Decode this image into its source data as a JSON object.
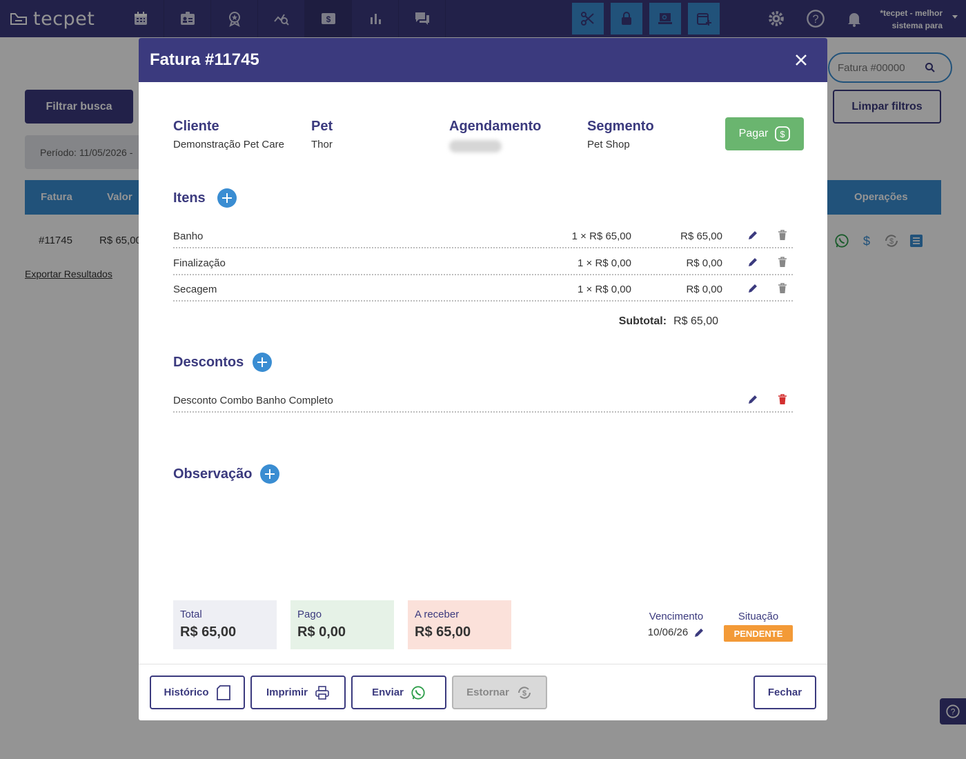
{
  "brand": {
    "name": "tecpet"
  },
  "user_menu": {
    "line1": "*tecpet - melhor",
    "line2": "sistema para"
  },
  "page": {
    "filter_button": "Filtrar busca",
    "period": "Período: 11/05/2026 -",
    "search_placeholder": "Fatura #00000",
    "clear_button": "Limpar filtros",
    "table": {
      "headers": {
        "fatura": "Fatura",
        "valor": "Valor",
        "operacoes": "Operações"
      },
      "row": {
        "fatura": "#11745",
        "valor": "R$ 65,00"
      }
    },
    "export_link": "Exportar Resultados"
  },
  "modal": {
    "title": "Fatura #11745",
    "info": {
      "cliente_label": "Cliente",
      "cliente": "Demonstração Pet Care",
      "pet_label": "Pet",
      "pet": "Thor",
      "agendamento_label": "Agendamento",
      "segmento_label": "Segmento",
      "segmento": "Pet Shop"
    },
    "pay_button": "Pagar",
    "items_title": "Itens",
    "items": [
      {
        "name": "Banho",
        "qty": "1 × R$ 65,00",
        "total": "R$ 65,00"
      },
      {
        "name": "Finalização",
        "qty": "1 × R$ 0,00",
        "total": "R$ 0,00"
      },
      {
        "name": "Secagem",
        "qty": "1 × R$ 0,00",
        "total": "R$ 0,00"
      }
    ],
    "subtotal_label": "Subtotal:",
    "subtotal_value": "R$ 65,00",
    "discounts_title": "Descontos",
    "discounts": [
      {
        "name": "Desconto Combo Banho Completo"
      }
    ],
    "observation_title": "Observação",
    "summary": {
      "total_label": "Total",
      "total": "R$ 65,00",
      "paid_label": "Pago",
      "paid": "R$ 0,00",
      "receivable_label": "A receber",
      "receivable": "R$ 65,00"
    },
    "due_label": "Vencimento",
    "due_date": "10/06/26",
    "status_label": "Situação",
    "status": "PENDENTE",
    "footer": {
      "history": "Histórico",
      "print": "Imprimir",
      "send": "Enviar",
      "refund": "Estornar",
      "close": "Fechar"
    }
  },
  "colors": {
    "primary": "#3b3a7e",
    "accent": "#3a8dd2",
    "pay": "#6ab56f",
    "status_pending": "#f39a37",
    "delete_active": "#d32f2f"
  }
}
